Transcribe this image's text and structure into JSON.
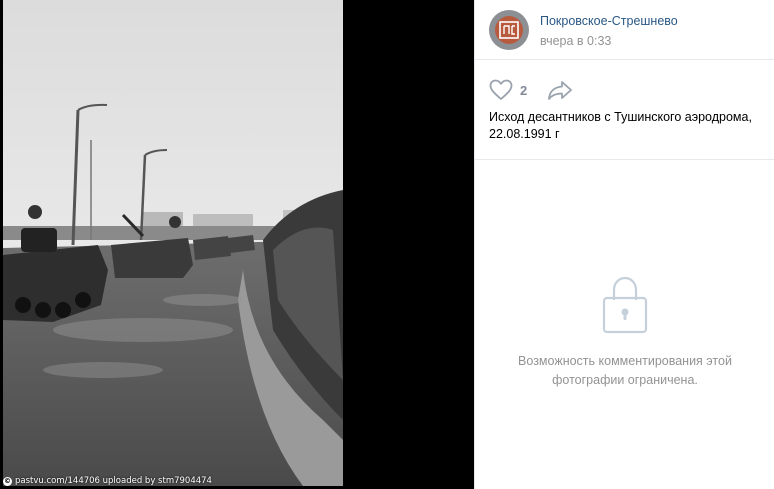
{
  "photo": {
    "watermark_logo": "©",
    "watermark": "pastvu.com/144706  uploaded by stm7904474"
  },
  "post": {
    "owner": "Покровское-Стрешнево",
    "time": "вчера в 0:33",
    "likes": "2",
    "caption_line1": "Исход десантников с Тушинского аэродрома,",
    "caption_line2": "22.08.1991 г"
  },
  "comments": {
    "restricted_line1": "Возможность комментирования этой",
    "restricted_line2": "фотографии ограничена."
  },
  "colors": {
    "link": "#2a5885",
    "muted": "#939393",
    "icon": "#99a2ad"
  },
  "icons": [
    "heart-icon",
    "share-icon",
    "lock-icon"
  ]
}
